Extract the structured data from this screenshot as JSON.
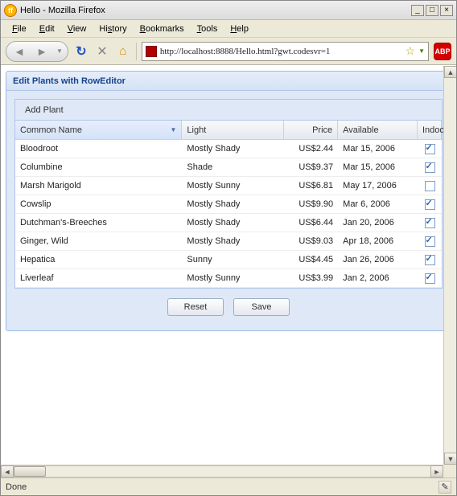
{
  "window": {
    "title": "Hello - Mozilla Firefox"
  },
  "window_controls": {
    "min": "_",
    "max": "□",
    "close": "×"
  },
  "menubar": [
    {
      "hot": "F",
      "label": "ile"
    },
    {
      "hot": "E",
      "label": "dit"
    },
    {
      "hot": "V",
      "label": "iew"
    },
    {
      "hot": "",
      "label": "Hi",
      "hot2": "s",
      "label2": "tory"
    },
    {
      "hot": "B",
      "label": "ookmarks"
    },
    {
      "hot": "T",
      "label": "ools"
    },
    {
      "hot": "H",
      "label": "elp"
    }
  ],
  "toolbar": {
    "address": "http://localhost:8888/Hello.html?gwt.codesvr=1"
  },
  "panel": {
    "title": "Edit Plants with RowEditor",
    "tbar": {
      "add": "Add Plant"
    },
    "headers": {
      "name": "Common Name",
      "light": "Light",
      "price": "Price",
      "available": "Available",
      "indoor": "Indoor"
    },
    "rows": [
      {
        "name": "Bloodroot",
        "light": "Mostly Shady",
        "price": "US$2.44",
        "available": "Mar 15, 2006",
        "indoor": true
      },
      {
        "name": "Columbine",
        "light": "Shade",
        "price": "US$9.37",
        "available": "Mar 15, 2006",
        "indoor": true
      },
      {
        "name": "Marsh Marigold",
        "light": "Mostly Sunny",
        "price": "US$6.81",
        "available": "May 17, 2006",
        "indoor": false
      },
      {
        "name": "Cowslip",
        "light": "Mostly Shady",
        "price": "US$9.90",
        "available": "Mar 6, 2006",
        "indoor": true
      },
      {
        "name": "Dutchman's-Breeches",
        "light": "Mostly Shady",
        "price": "US$6.44",
        "available": "Jan 20, 2006",
        "indoor": true
      },
      {
        "name": "Ginger, Wild",
        "light": "Mostly Shady",
        "price": "US$9.03",
        "available": "Apr 18, 2006",
        "indoor": true
      },
      {
        "name": "Hepatica",
        "light": "Sunny",
        "price": "US$4.45",
        "available": "Jan 26, 2006",
        "indoor": true
      },
      {
        "name": "Liverleaf",
        "light": "Mostly Sunny",
        "price": "US$3.99",
        "available": "Jan 2, 2006",
        "indoor": true
      }
    ],
    "buttons": {
      "reset": "Reset",
      "save": "Save"
    }
  },
  "status": {
    "text": "Done"
  }
}
